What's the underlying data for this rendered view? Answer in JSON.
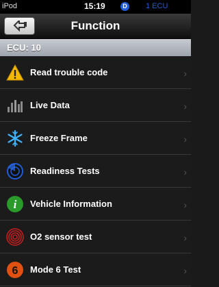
{
  "status": {
    "carrier": "iPod",
    "time": "15:19",
    "badge": "D",
    "ecu": "1 ECU"
  },
  "nav": {
    "title": "Function"
  },
  "ecu_header": "ECU: 10",
  "items": [
    {
      "label": "Read trouble code",
      "icon": "warning-icon"
    },
    {
      "label": "Live Data",
      "icon": "bar-chart-icon"
    },
    {
      "label": "Freeze Frame",
      "icon": "snowflake-icon"
    },
    {
      "label": "Readiness Tests",
      "icon": "radar-icon"
    },
    {
      "label": "Vehicle Information",
      "icon": "info-icon"
    },
    {
      "label": "O2 sensor test",
      "icon": "sensor-rings-icon"
    },
    {
      "label": "Mode 6 Test",
      "icon": "mode6-icon"
    }
  ],
  "colors": {
    "accent": "#1f5ed8",
    "warning": "#f5b800",
    "info": "#2a9a2a",
    "sensor": "#c0201e",
    "mode6": "#e05010"
  }
}
